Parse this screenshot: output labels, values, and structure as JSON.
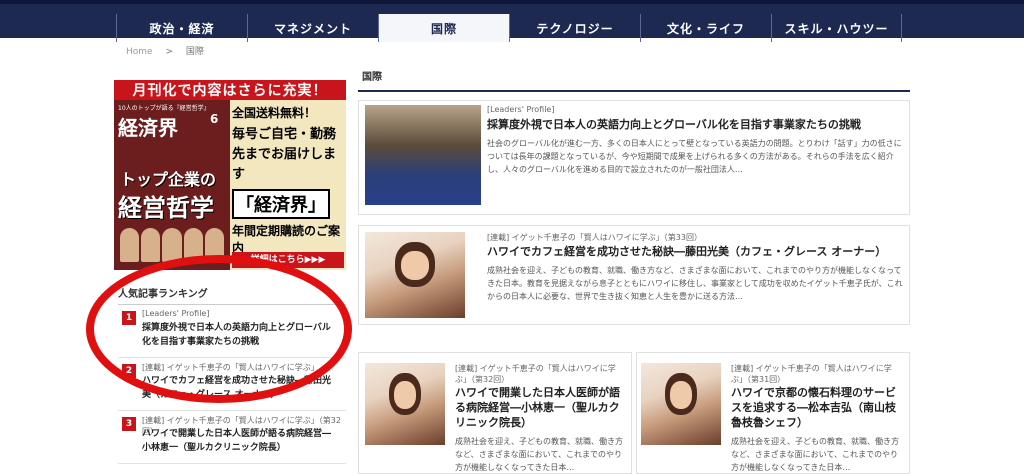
{
  "nav": {
    "items": [
      "政治・経済",
      "マネジメント",
      "国際",
      "テクノロジー",
      "文化・ライフ",
      "スキル・ハウツー"
    ],
    "active_index": 2
  },
  "breadcrumb": {
    "home": "Home",
    "sep": ">",
    "current": "国際"
  },
  "banner": {
    "top": "月刊化で内容はさらに充実！",
    "mag_head": "10人のトップが語る『経営哲学』",
    "mag_title": "経済界",
    "mag_issue": "6",
    "mag_feature1": "トップ企業の",
    "mag_feature2": "経営哲学",
    "line1": "全国送料無料！",
    "line2": "毎号ご自宅・勤務先までお届けします",
    "line3": "「経済界」",
    "line4": "年間定期購読のご案内",
    "cta": "詳細はこちら▶▶▶"
  },
  "ranking": {
    "title": "人気記事ランキング",
    "items": [
      {
        "num": "1",
        "meta": "[Leaders' Profile]",
        "title": "採算度外視で日本人の英語力向上とグローバル化を目指す事業家たちの挑戦"
      },
      {
        "num": "2",
        "meta": "[連載] イゲット千恵子の「賢人はハワイに学ぶ」",
        "title": "ハワイでカフェ経営を成功させた秘訣―藤田光美（カフェ・グレース オーナー）"
      },
      {
        "num": "3",
        "meta": "[連載] イゲット千恵子の「賢人はハワイに学ぶ」（第32回）",
        "title": "ハワイで開業した日本人医師が語る病院経営―小林恵一（聖ルカクリニック院長）"
      }
    ]
  },
  "main": {
    "section_title": "国際",
    "articles": [
      {
        "meta": "[Leaders' Profile]",
        "title": "採算度外視で日本人の英語力向上とグローバル化を目指す事業家たちの挑戦",
        "desc": "社会のグローバル化が進む一方、多くの日本人にとって壁となっている英語力の問題。とりわけ「話す」力の低さについては長年の課題となっているが、今や短期間で成果を上げられる多くの方法がある。それらの手法を広く紹介し、人々のグローバル化を進める目的で設立されたのが一般社団法人…"
      },
      {
        "meta": "[連載] イゲット千恵子の「賢人はハワイに学ぶ」（第33回）",
        "title": "ハワイでカフェ経営を成功させた秘訣―藤田光美（カフェ・グレース オーナー）",
        "desc": "成熟社会を迎え、子どもの教育、就職、働き方など、さまざまな面において、これまでのやり方が機能しなくなってきた日本。教育を見据えながら息子とともにハワイに移住し、事業家として成功を収めたイゲット千恵子氏が、これからの日本人に必要な、世界で生き抜く知恵と人生を豊かに送る方法…"
      },
      {
        "meta": "[連載] イゲット千恵子の「賢人はハワイに学ぶ」（第32回）",
        "title": "ハワイで開業した日本人医師が語る病院経営―小林恵一（聖ルカクリニック院長）",
        "desc": "成熟社会を迎え、子どもの教育、就職、働き方など、さまざまな面において、これまでのやり方が機能しなくなってきた日本…"
      },
      {
        "meta": "[連載] イゲット千恵子の「賢人はハワイに学ぶ」（第31回）",
        "title": "ハワイで京都の懐石料理のサービスを追求する―松本吉弘（南山枝魯枝魯シェフ）",
        "desc": "成熟社会を迎え、子どもの教育、就職、働き方など、さまざまな面において、これまでのやり方が機能しなくなってきた日本…"
      }
    ]
  }
}
